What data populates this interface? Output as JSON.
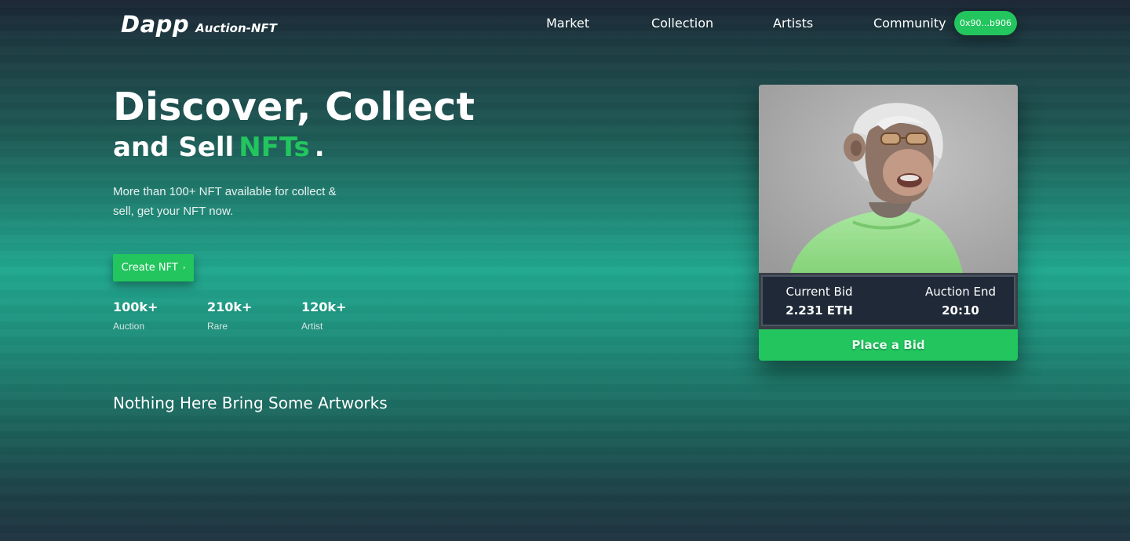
{
  "nav": {
    "logo_main": "Dapp",
    "logo_sub": "Auction-NFT",
    "links": [
      "Market",
      "Collection",
      "Artists",
      "Community"
    ],
    "wallet_address": "0x90...b906"
  },
  "hero": {
    "title_line1": "Discover, Collect",
    "title_line2_prefix": "and Sell",
    "title_line2_accent": "NFTs",
    "title_line2_suffix": ".",
    "description": "More than 100+ NFT available for collect & sell, get your NFT now.",
    "create_button_label": "Create NFT",
    "create_button_arrow": "›",
    "stats": [
      {
        "value": "100k+",
        "label": "Auction"
      },
      {
        "value": "210k+",
        "label": "Rare"
      },
      {
        "value": "120k+",
        "label": "Artist"
      }
    ]
  },
  "card": {
    "current_bid_label": "Current Bid",
    "current_bid_value": "2.231 ETH",
    "auction_end_label": "Auction End",
    "auction_end_value": "20:10",
    "place_bid_label": "Place a Bid"
  },
  "artworks": {
    "empty_message": "Nothing Here Bring Some Artworks"
  },
  "colors": {
    "accent": "#22c55e",
    "panel": "#1f2937"
  }
}
